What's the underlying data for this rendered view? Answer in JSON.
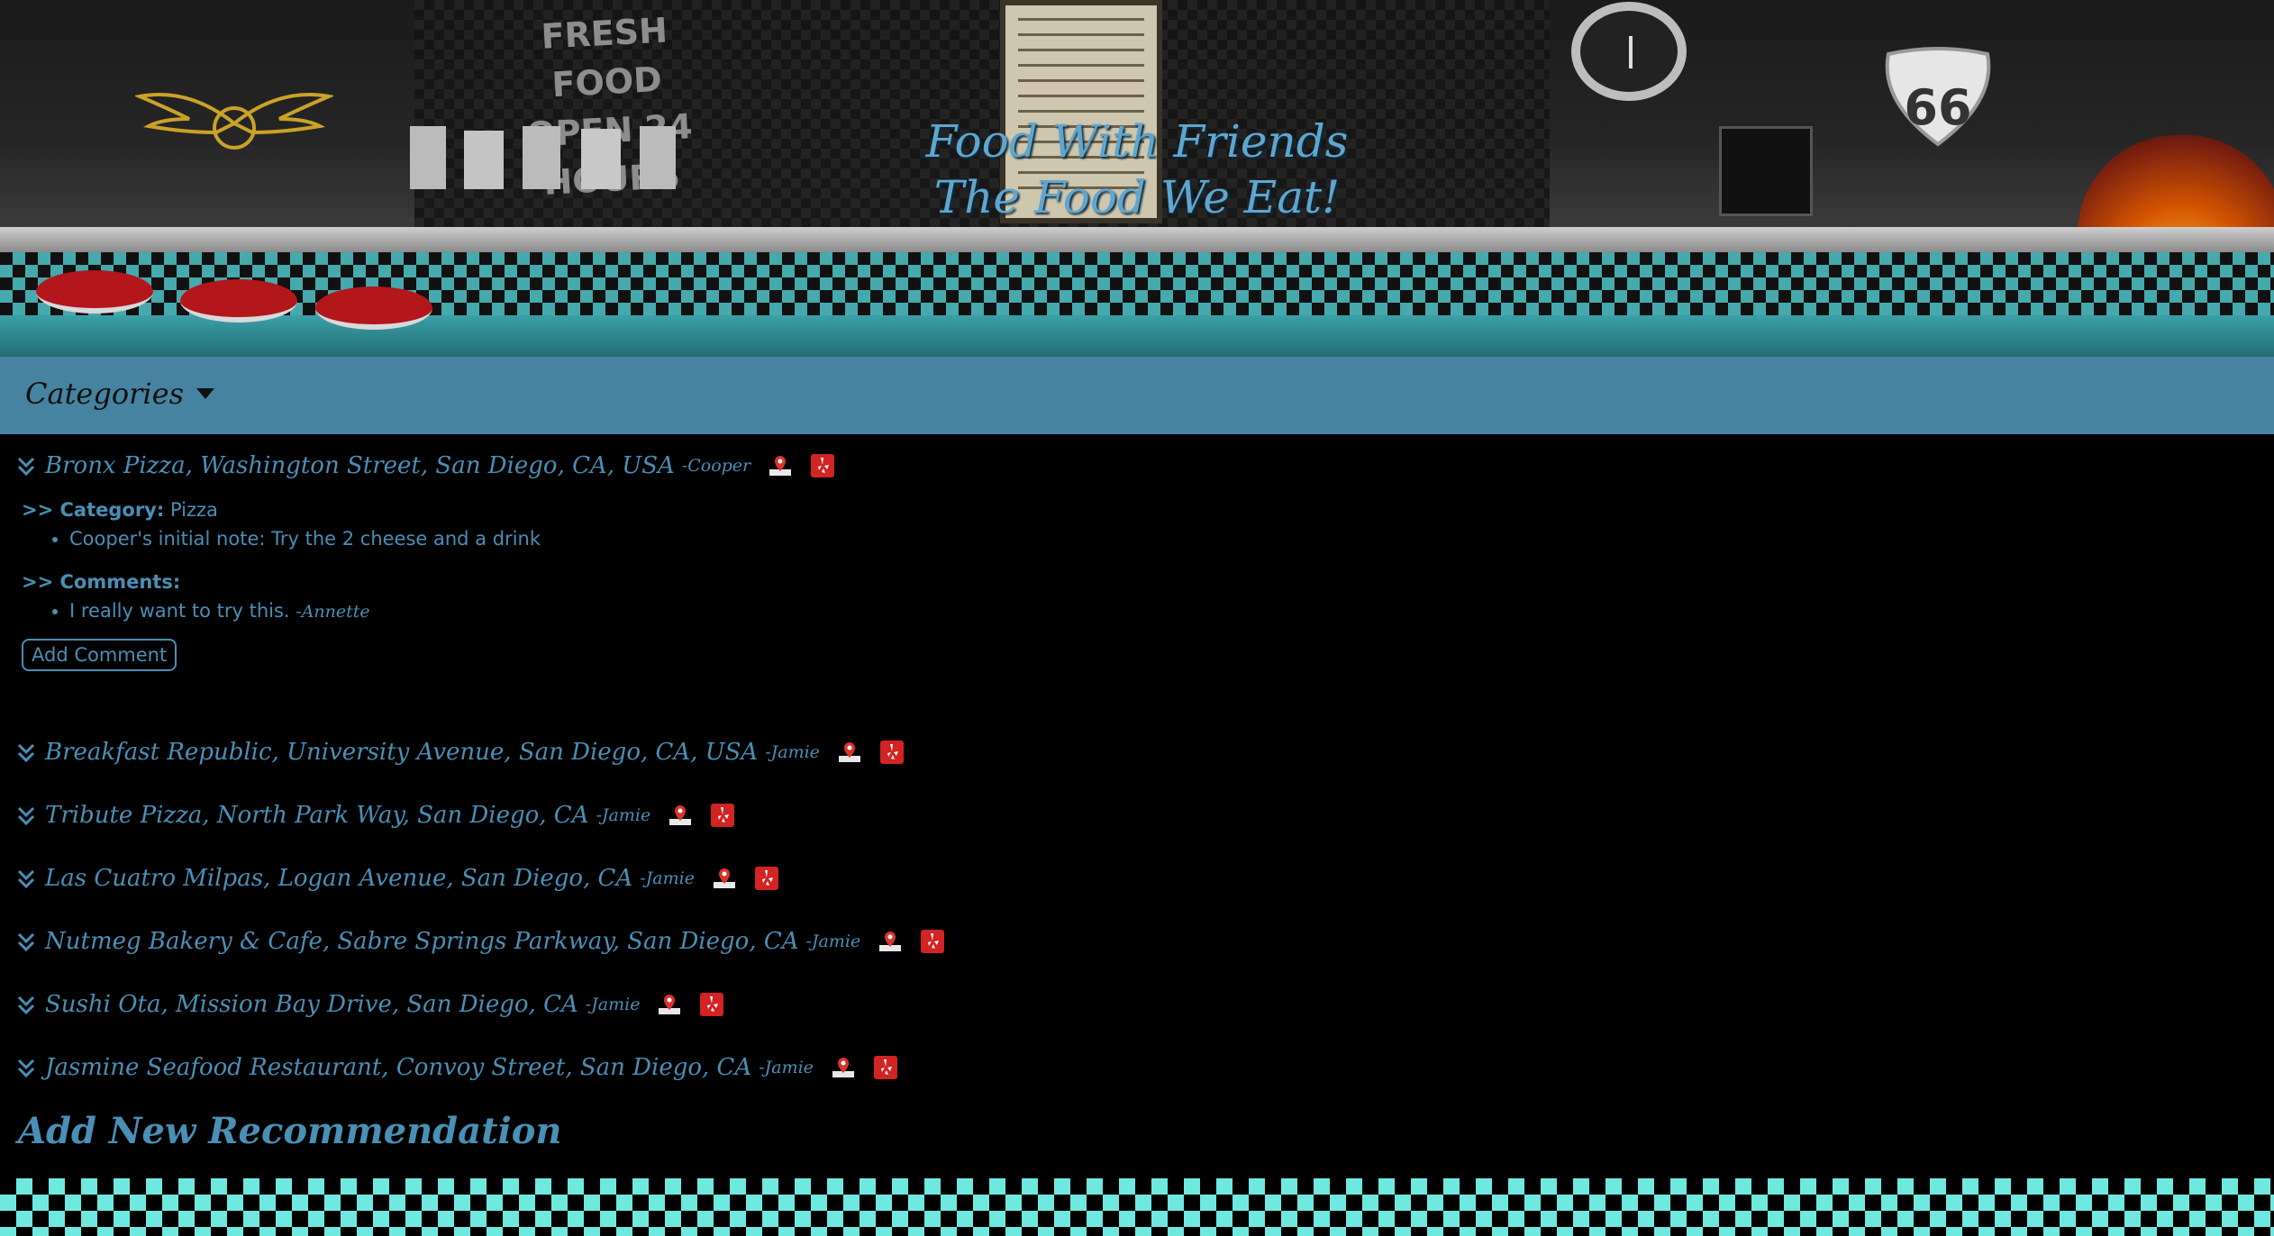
{
  "banner": {
    "title_line1": "Food With Friends",
    "title_line2": "The Food We Eat!",
    "sign_line1": "FRESH FOOD",
    "sign_line2": "OPEN 24 HOURS",
    "shield_text": "66"
  },
  "nav": {
    "categories_label": "Categories"
  },
  "recommendations": [
    {
      "title": "Bronx Pizza, Washington Street, San Diego, CA, USA",
      "by": "-Cooper",
      "expanded": true
    },
    {
      "title": "Breakfast Republic, University Avenue, San Diego, CA, USA",
      "by": "-Jamie"
    },
    {
      "title": "Tribute Pizza, North Park Way, San Diego, CA",
      "by": "-Jamie"
    },
    {
      "title": "Las Cuatro Milpas, Logan Avenue, San Diego, CA",
      "by": "-Jamie"
    },
    {
      "title": "Nutmeg Bakery & Cafe, Sabre Springs Parkway, San Diego, CA",
      "by": "-Jamie"
    },
    {
      "title": "Sushi Ota, Mission Bay Drive, San Diego, CA",
      "by": "-Jamie"
    },
    {
      "title": "Jasmine Seafood Restaurant, Convoy Street, San Diego, CA",
      "by": "-Jamie"
    }
  ],
  "details": {
    "category_label": ">> Category:",
    "category_value": "Pizza",
    "initial_note": "Cooper's initial note: Try the 2 cheese and a drink",
    "comments_label": ">> Comments:",
    "comment_text": "I really want to try this.",
    "comment_by": "-Annette",
    "add_comment_label": "Add Comment"
  },
  "add_recommendation_label": "Add New Recommendation",
  "colors": {
    "text_accent": "#4a8fb5",
    "navbar": "#4683a0",
    "footer_check": "#6fe9df",
    "background": "#000000"
  },
  "icons": [
    "chevrons-down-icon",
    "map-pin-icon",
    "yelp-icon",
    "caret-down-icon"
  ]
}
